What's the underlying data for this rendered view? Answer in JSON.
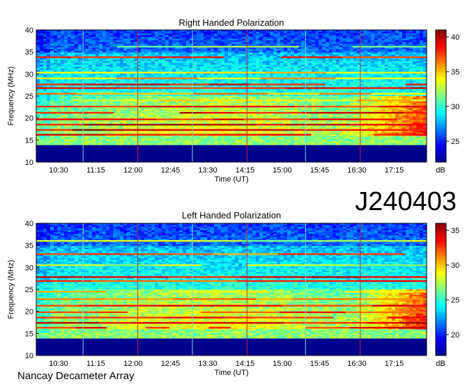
{
  "figure": {
    "obs_id": "J240403",
    "instrument": "Nancay Decameter Array"
  },
  "chart_data": [
    {
      "type": "heatmap",
      "title": "Right Handed Polarization",
      "xlabel": "Time (UT)",
      "ylabel": "Frequency (MHz)",
      "x_tick_labels": [
        "10:30",
        "11:15",
        "12:00",
        "12:45",
        "13:30",
        "14:15",
        "15:00",
        "15:45",
        "16:30",
        "17:15"
      ],
      "y_ticks": [
        10,
        15,
        20,
        25,
        30,
        35,
        40
      ],
      "ylim": [
        10,
        40
      ],
      "colorbar": {
        "label": "dB",
        "ticks": [
          25,
          30,
          35,
          40
        ],
        "range": [
          22,
          41
        ]
      },
      "cutoff_mhz": 14,
      "bands": [
        {
          "f": 16.2,
          "level": 0.95
        },
        {
          "f": 17.3,
          "level": 0.98
        },
        {
          "f": 18.5,
          "level": 0.98
        },
        {
          "f": 19.7,
          "level": 0.96
        },
        {
          "f": 21.2,
          "level": 0.97
        },
        {
          "f": 22.6,
          "level": 0.92
        },
        {
          "f": 24.0,
          "level": 0.72
        },
        {
          "f": 25.5,
          "level": 0.78
        },
        {
          "f": 26.8,
          "level": 0.94
        },
        {
          "f": 27.6,
          "level": 0.95
        },
        {
          "f": 29.0,
          "level": 0.75
        },
        {
          "f": 30.3,
          "level": 0.7
        },
        {
          "f": 33.8,
          "level": 0.9
        },
        {
          "f": 36.2,
          "level": 0.62
        }
      ],
      "vertical_lines_fraction": [
        0.12,
        0.26,
        0.4,
        0.54,
        0.69,
        0.83
      ],
      "evening_excess_start_fraction": 0.78
    },
    {
      "type": "heatmap",
      "title": "Left Handed Polarization",
      "xlabel": "Time (UT)",
      "ylabel": "Frequency (MHz)",
      "x_tick_labels": [
        "10:30",
        "11:15",
        "12:00",
        "12:45",
        "13:30",
        "14:15",
        "15:00",
        "15:45",
        "16:30",
        "17:15"
      ],
      "y_ticks": [
        10,
        15,
        20,
        25,
        30,
        35,
        40
      ],
      "ylim": [
        10,
        40
      ],
      "colorbar": {
        "label": "dB",
        "ticks": [
          20,
          25,
          30,
          35
        ],
        "range": [
          17,
          36
        ]
      },
      "cutoff_mhz": 14,
      "bands": [
        {
          "f": 16.3,
          "level": 0.93
        },
        {
          "f": 17.4,
          "level": 0.97
        },
        {
          "f": 18.6,
          "level": 0.96
        },
        {
          "f": 19.8,
          "level": 0.88
        },
        {
          "f": 21.3,
          "level": 0.92
        },
        {
          "f": 22.8,
          "level": 0.82
        },
        {
          "f": 24.5,
          "level": 0.7
        },
        {
          "f": 26.9,
          "level": 0.9
        },
        {
          "f": 27.8,
          "level": 0.94
        },
        {
          "f": 30.5,
          "level": 0.66
        },
        {
          "f": 33.0,
          "level": 0.85
        },
        {
          "f": 36.0,
          "level": 0.62
        }
      ],
      "vertical_lines_fraction": [
        0.12,
        0.26,
        0.4,
        0.54,
        0.69,
        0.83
      ],
      "evening_excess_start_fraction": 0.8
    }
  ]
}
